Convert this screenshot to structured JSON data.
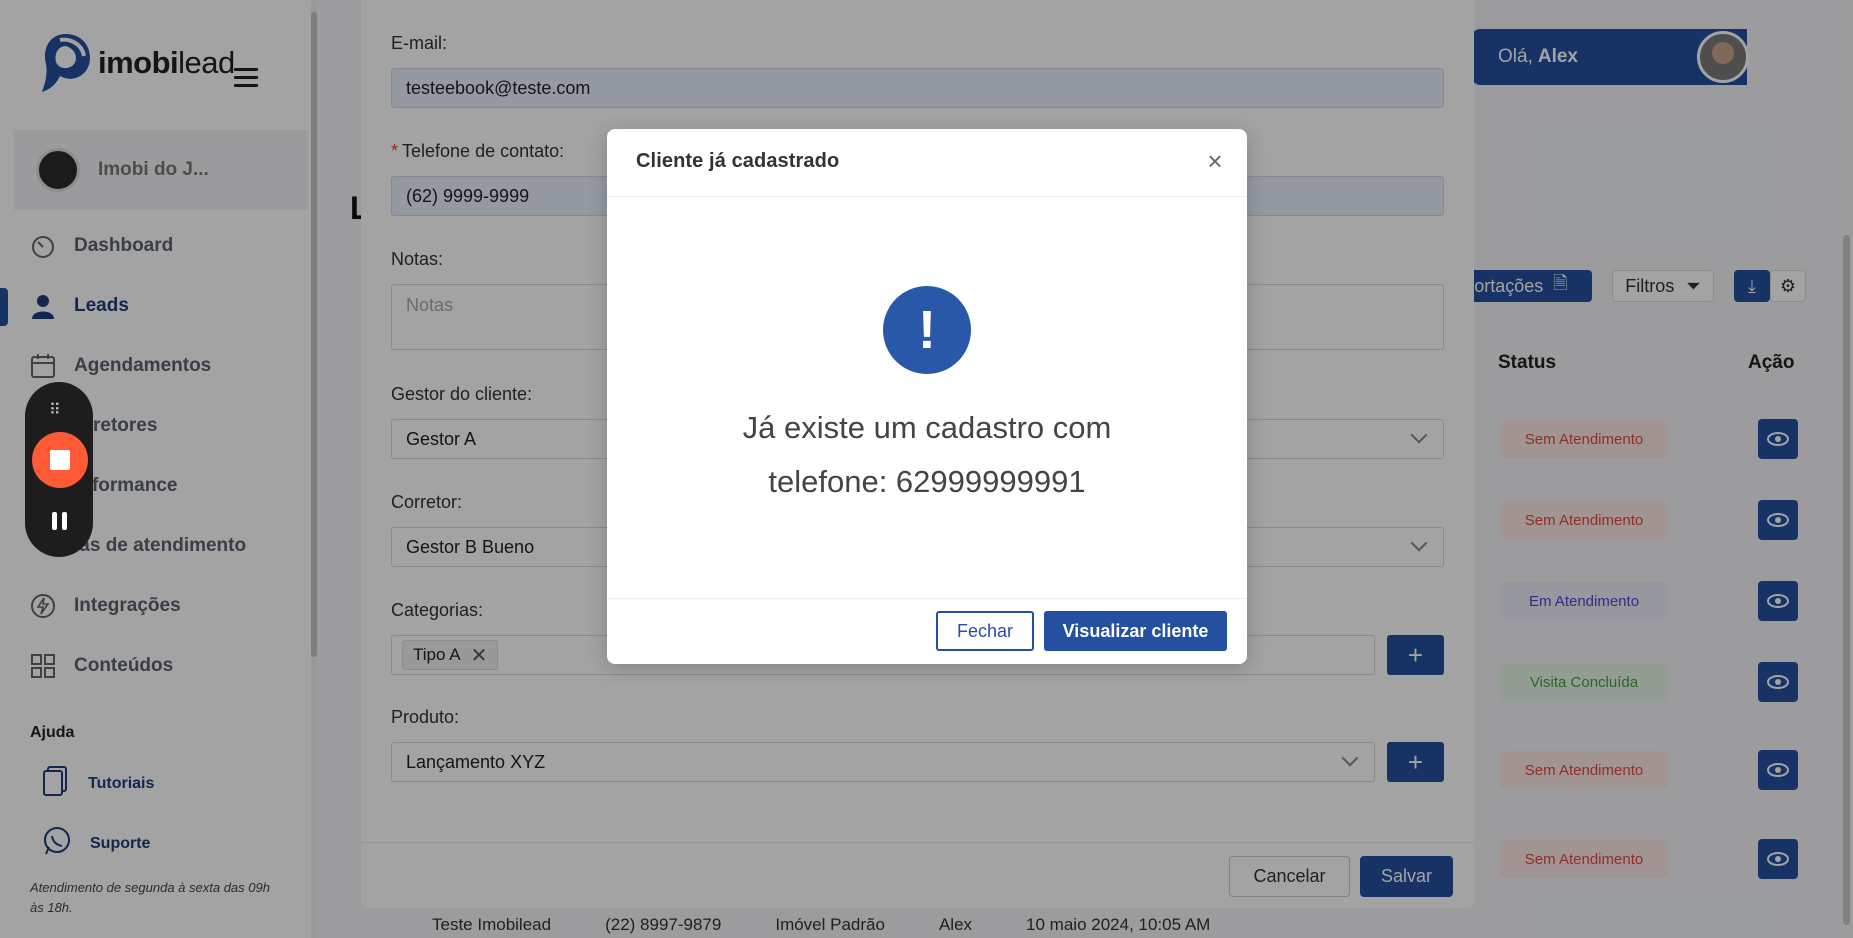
{
  "brand": {
    "name": "imobilead",
    "name_bold": "imobi",
    "name_light": "lead"
  },
  "tenant": {
    "name": "Imobi do J..."
  },
  "sidebar": {
    "items": [
      {
        "label": "Dashboard",
        "icon": "dashboard-gauge-icon"
      },
      {
        "label": "Leads",
        "icon": "user-icon"
      },
      {
        "label": "Agendamentos",
        "icon": "calendar-icon"
      },
      {
        "label": "Corretores",
        "icon": "users-icon"
      },
      {
        "label": "Performance",
        "icon": "chart-icon"
      },
      {
        "label": "Filas de atendimento",
        "icon": "queue-icon"
      },
      {
        "label": "Integrações",
        "icon": "lightning-icon"
      },
      {
        "label": "Conteúdos",
        "icon": "grid-icon"
      }
    ],
    "visible_labels": [
      "Dashboard",
      "Leads",
      "Agendamentos",
      "orretores",
      "erformance",
      "las de atendimento",
      "Integrações",
      "Conteúdos"
    ],
    "help_title": "Ajuda",
    "help_items": [
      {
        "label": "Tutoriais",
        "icon": "document-icon"
      },
      {
        "label": "Suporte",
        "icon": "whatsapp-icon"
      }
    ],
    "support_note": "Atendimento de segunda à sexta das 09h às 18h."
  },
  "header": {
    "greeting": "Olá,",
    "user_name": "Alex"
  },
  "page": {
    "title_partial": "L",
    "toolbar": {
      "import_label": "ortações",
      "filter_label": "Filtros"
    },
    "columns": {
      "status": "Status",
      "action": "Ação"
    },
    "rows": [
      {
        "status": "Sem Atendimento",
        "status_color": "#e2483d"
      },
      {
        "status": "Sem Atendimento",
        "status_color": "#e2483d"
      },
      {
        "status": "Em Atendimento",
        "status_color": "#4a4ad0"
      },
      {
        "status": "Visita Concluída",
        "status_color": "#3aa63a"
      },
      {
        "status": "Sem Atendimento",
        "status_color": "#e2483d"
      },
      {
        "status": "Sem Atendimento",
        "status_color": "#e2483d"
      }
    ],
    "bottom_row": [
      "Teste Imobilead",
      "(22) 8997-9879",
      "Imóvel Padrão",
      "Alex",
      "10 maio 2024, 10:05 AM"
    ]
  },
  "form": {
    "email_label": "E-mail:",
    "email_value": "testeebook@teste.com",
    "phone_label": "Telefone de contato:",
    "phone_value": "(62) 9999-9999",
    "notes_label": "Notas:",
    "notes_placeholder": "Notas",
    "manager_label": "Gestor do cliente:",
    "manager_value": "Gestor A",
    "broker_label": "Corretor:",
    "broker_value": "Gestor B Bueno",
    "categories_label": "Categorias:",
    "category_tag": "Tipo A",
    "product_label": "Produto:",
    "product_value": "Lançamento XYZ",
    "cancel_label": "Cancelar",
    "save_label": "Salvar"
  },
  "alert": {
    "title": "Cliente já cadastrado",
    "icon_glyph": "!",
    "message_line1": "Já existe um cadastro com",
    "message_line2": "telefone: 62999999991",
    "close_label": "Fechar",
    "view_label": "Visualizar cliente"
  },
  "colors": {
    "brand": "#2450a0",
    "danger": "#e2483d",
    "recorder_stop": "#ff5a36"
  }
}
